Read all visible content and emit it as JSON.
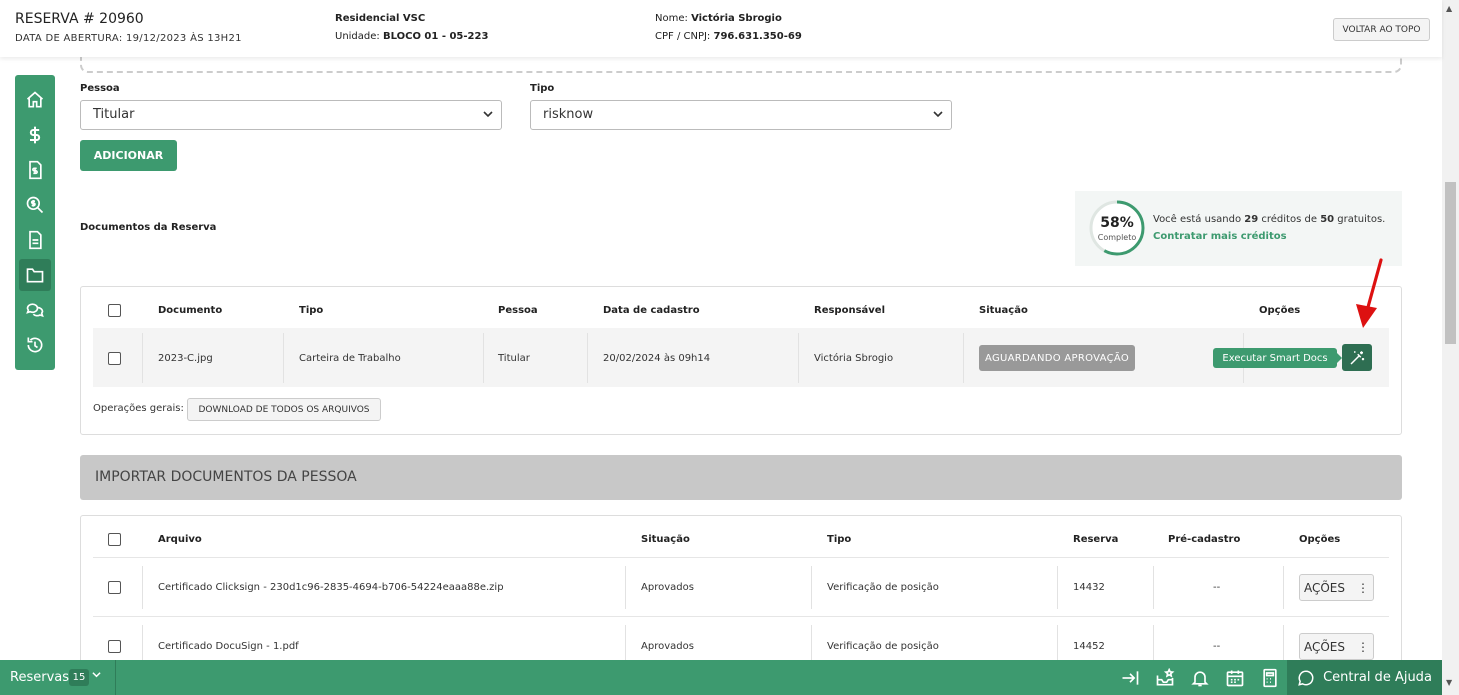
{
  "header": {
    "reserva_title": "RESERVA # 20960",
    "data_abertura": "DATA DE ABERTURA: 19/12/2023 ÀS 13H21",
    "empreendimento": "Residencial VSC",
    "unidade_label": "Unidade:",
    "unidade_value": "BLOCO 01 - 05-223",
    "nome_label": "Nome:",
    "nome_value": "Victória Sbrogio",
    "cpf_label": "CPF / CNPJ:",
    "cpf_value": "796.631.350-69",
    "voltar_topo": "VOLTAR AO TOPO"
  },
  "form": {
    "pessoa_label": "Pessoa",
    "pessoa_value": "Titular",
    "tipo_label": "Tipo",
    "tipo_value": "risknow",
    "adicionar": "ADICIONAR"
  },
  "documents": {
    "title": "Documentos da Reserva",
    "credits": {
      "percent": "58%",
      "percent_value": 0.58,
      "completo": "Completo",
      "text_prefix": "Você está usando",
      "used": "29",
      "text_mid": "créditos de",
      "total": "50",
      "text_suffix": "gratuitos.",
      "link": "Contratar mais créditos"
    },
    "columns": [
      "Documento",
      "Tipo",
      "Pessoa",
      "Data de cadastro",
      "Responsável",
      "Situação",
      "Opções"
    ],
    "rows": [
      {
        "documento": "2023-C.jpg",
        "tipo": "Carteira de Trabalho",
        "pessoa": "Titular",
        "data": "20/02/2024 às 09h14",
        "responsavel": "Victória Sbrogio",
        "situacao": "AGUARDANDO APROVAÇÃO"
      }
    ],
    "tooltip": "Executar Smart Docs",
    "operacoes_label": "Operações gerais:",
    "download_all": "DOWNLOAD DE TODOS OS ARQUIVOS"
  },
  "import": {
    "title": "IMPORTAR DOCUMENTOS DA PESSOA",
    "columns": [
      "Arquivo",
      "Situação",
      "Tipo",
      "Reserva",
      "Pré-cadastro",
      "Opções"
    ],
    "rows": [
      {
        "arquivo": "Certificado Clicksign - 230d1c96-2835-4694-b706-54224eaaa88e.zip",
        "situacao": "Aprovados",
        "tipo": "Verificação de posição",
        "reserva": "14432",
        "precadastro": "--",
        "acoes": "AÇÕES"
      },
      {
        "arquivo": "Certificado DocuSign - 1.pdf",
        "situacao": "Aprovados",
        "tipo": "Verificação de posição",
        "reserva": "14452",
        "precadastro": "--",
        "acoes": "AÇÕES"
      }
    ]
  },
  "bottombar": {
    "reservas": "Reservas",
    "count": "15",
    "help": "Central de Ajuda"
  },
  "colors": {
    "accent": "#3d9a6f",
    "accent_dark": "#2e6e52",
    "status_gray": "#999999",
    "arrow_red": "#dd1111"
  },
  "icons": [
    "home-icon",
    "dollar-icon",
    "invoice-icon",
    "search-money-icon",
    "document-icon",
    "folder-icon",
    "chat-icon",
    "history-icon",
    "magic-wand-icon",
    "login-icon",
    "inbox-star-icon",
    "bell-icon",
    "calendar-icon",
    "calculator-icon",
    "help-chat-icon"
  ]
}
